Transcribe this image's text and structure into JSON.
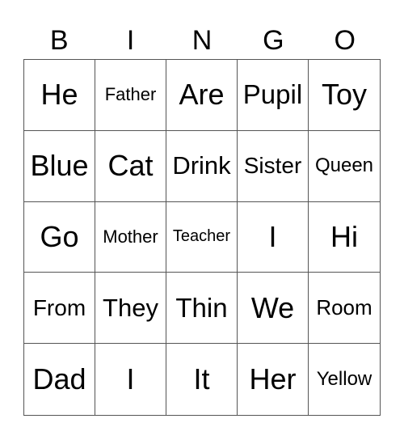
{
  "header": [
    "B",
    "I",
    "N",
    "G",
    "O"
  ],
  "cells": [
    [
      "He",
      "Father",
      "Are",
      "Pupil",
      "Toy"
    ],
    [
      "Blue",
      "Cat",
      "Drink",
      "Sister",
      "Queen"
    ],
    [
      "Go",
      "Mother",
      "Teacher",
      "I",
      "Hi"
    ],
    [
      "From",
      "They",
      "Thin",
      "We",
      "Room"
    ],
    [
      "Dad",
      "I",
      "It",
      "Her",
      "Yellow"
    ]
  ]
}
